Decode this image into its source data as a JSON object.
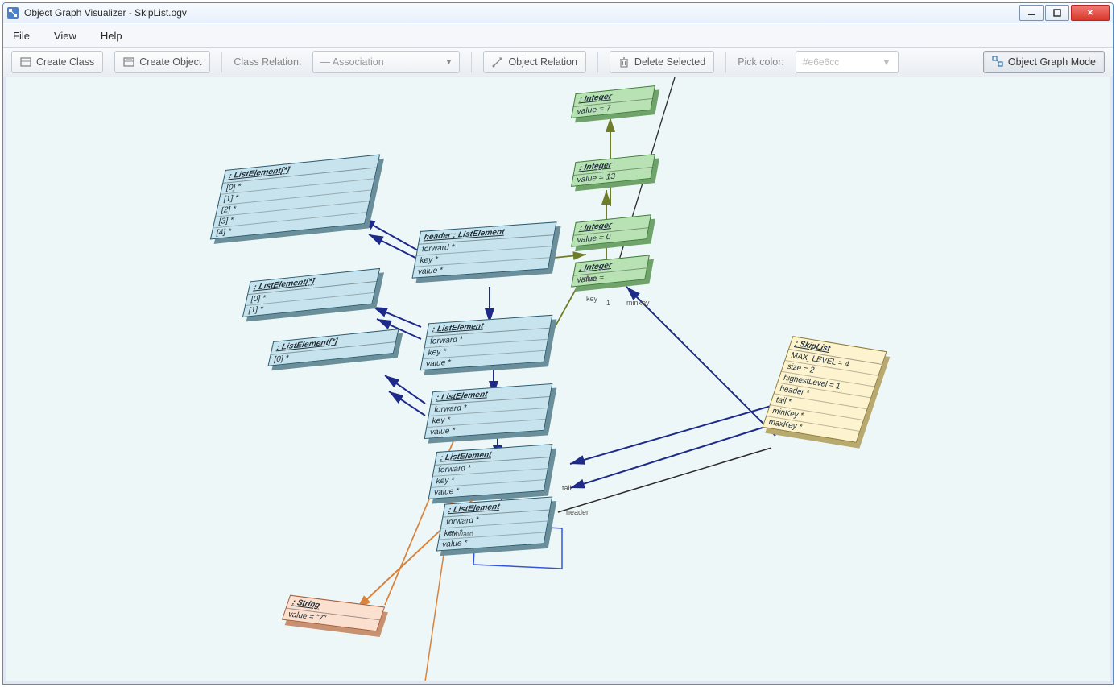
{
  "window": {
    "title": "Object Graph Visualizer - SkipList.ogv"
  },
  "menu": {
    "file": "File",
    "view": "View",
    "help": "Help"
  },
  "toolbar": {
    "create_class": "Create Class",
    "create_object": "Create Object",
    "class_relation_label": "Class Relation:",
    "relation_selected": "—  Association",
    "object_relation": "Object Relation",
    "delete_selected": "Delete Selected",
    "pick_color_label": "Pick color:",
    "color_value": "#e6e6cc",
    "mode": "Object Graph Mode"
  },
  "nodes": {
    "listArr0": {
      "title": ": ListElement[*]",
      "rows": [
        "[0] *",
        "[1] *",
        "[2] *",
        "[3] *",
        "[4] *"
      ]
    },
    "listArr1": {
      "title": ": ListElement[*]",
      "rows": [
        "[0] *",
        "[1] *"
      ]
    },
    "listArr2": {
      "title": ": ListElement[*]",
      "rows": [
        "[0] *"
      ]
    },
    "header": {
      "title": "header : ListElement",
      "rows": [
        "forward *",
        "key *",
        "value *"
      ]
    },
    "le1": {
      "title": ": ListElement",
      "rows": [
        "forward *",
        "key *",
        "value *"
      ]
    },
    "le2": {
      "title": ": ListElement",
      "rows": [
        "forward *",
        "key *",
        "value *"
      ]
    },
    "le3": {
      "title": ": ListElement",
      "rows": [
        "forward *",
        "key *",
        "value *"
      ]
    },
    "le4": {
      "title": ": ListElement",
      "rows": [
        "forward *",
        "key *",
        "value *"
      ]
    },
    "int0": {
      "title": ": Integer",
      "rows": [
        "value = 7"
      ]
    },
    "int1": {
      "title": ": Integer",
      "rows": [
        "value = 13"
      ]
    },
    "int2": {
      "title": ": Integer",
      "rows": [
        "value = 0"
      ]
    },
    "int3": {
      "title": ": Integer",
      "rows": [
        "value ="
      ]
    },
    "skip": {
      "title": ": SkipList",
      "rows": [
        "MAX_LEVEL = 4",
        "size = 2",
        "highestLevel = 1",
        "header *",
        "tail *",
        "minKey *",
        "maxKey *"
      ]
    },
    "str": {
      "title": ": String",
      "rows": [
        "value = \"7\""
      ]
    }
  },
  "edge_labels": {
    "key": "key",
    "value": "value",
    "minkey": "minkey",
    "tail": "tail",
    "header": "header",
    "forward": "forward",
    "one": "1"
  }
}
